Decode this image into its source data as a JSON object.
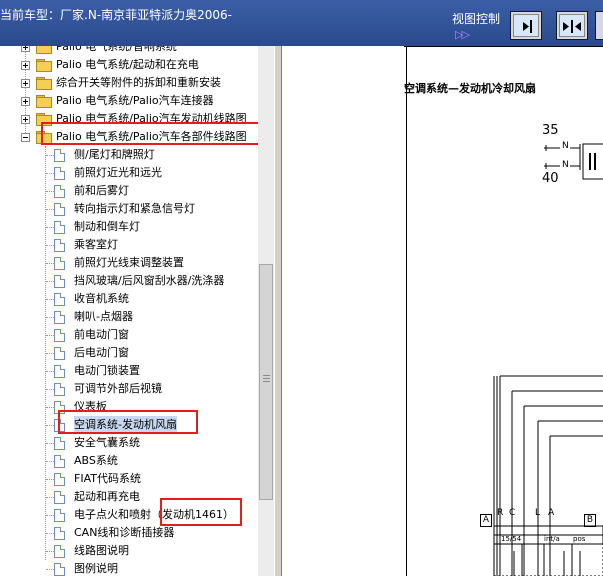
{
  "window": {
    "title": "当前车型：厂家.N-南京菲亚特派力奥2006-",
    "view_control_label": "视图控制",
    "view_control_arrow": "▷▷"
  },
  "tree": {
    "items": [
      {
        "label": "Palio 电气系统/音响系统",
        "type": "folder",
        "expander": "plus"
      },
      {
        "label": "Palio 电气系统/起动和在充电",
        "type": "folder",
        "expander": "plus"
      },
      {
        "label": "综合开关等附件的拆卸和重新安装",
        "type": "folder",
        "expander": "plus"
      },
      {
        "label": "Palio 电气系统/Palio汽车连接器",
        "type": "folder",
        "expander": "plus"
      },
      {
        "label": "Palio 电气系统/Palio汽车发动机线路图",
        "type": "folder",
        "expander": "plus"
      },
      {
        "label": "Palio 电气系统/Palio汽车各部件线路图",
        "type": "folder",
        "expander": "minus"
      },
      {
        "label": "侧/尾灯和牌照灯",
        "type": "doc"
      },
      {
        "label": "前照灯近光和远光",
        "type": "doc"
      },
      {
        "label": "前和后雾灯",
        "type": "doc"
      },
      {
        "label": "转向指示灯和紧急信号灯",
        "type": "doc"
      },
      {
        "label": "制动和倒车灯",
        "type": "doc"
      },
      {
        "label": "乘客室灯",
        "type": "doc"
      },
      {
        "label": "前照灯光线束调整装置",
        "type": "doc"
      },
      {
        "label": "挡风玻璃/后风窗刮水器/洗涤器",
        "type": "doc"
      },
      {
        "label": "收音机系统",
        "type": "doc"
      },
      {
        "label": "喇叭-点烟器",
        "type": "doc"
      },
      {
        "label": "前电动门窗",
        "type": "doc"
      },
      {
        "label": "后电动门窗",
        "type": "doc"
      },
      {
        "label": "电动门锁装置",
        "type": "doc"
      },
      {
        "label": "可调节外部后视镜",
        "type": "doc"
      },
      {
        "label": "仪表板",
        "type": "doc"
      },
      {
        "label": "空调系统-发动机风扇",
        "type": "doc",
        "selected": true
      },
      {
        "label": "安全气囊系统",
        "type": "doc"
      },
      {
        "label": "ABS系统",
        "type": "doc"
      },
      {
        "label": "FIAT代码系统",
        "type": "doc"
      },
      {
        "label": "起动和再充电",
        "type": "doc"
      },
      {
        "label": "电子点火和喷射（发动机1461）",
        "type": "doc"
      },
      {
        "label": "CAN线和诊断插接器",
        "type": "doc"
      },
      {
        "label": "线路图说明",
        "type": "doc"
      },
      {
        "label": "图例说明",
        "type": "doc"
      }
    ]
  },
  "diagram": {
    "title": "空调系统—发动机冷却风扇",
    "num_top": "35",
    "num_bottom": "40",
    "wire_n1": "N",
    "wire_n2": "N",
    "pins": [
      "R",
      "C",
      "L",
      "A"
    ],
    "box_a": "A",
    "box_b": "B",
    "small_labels": [
      "15/54",
      "int/a",
      "pos"
    ]
  }
}
